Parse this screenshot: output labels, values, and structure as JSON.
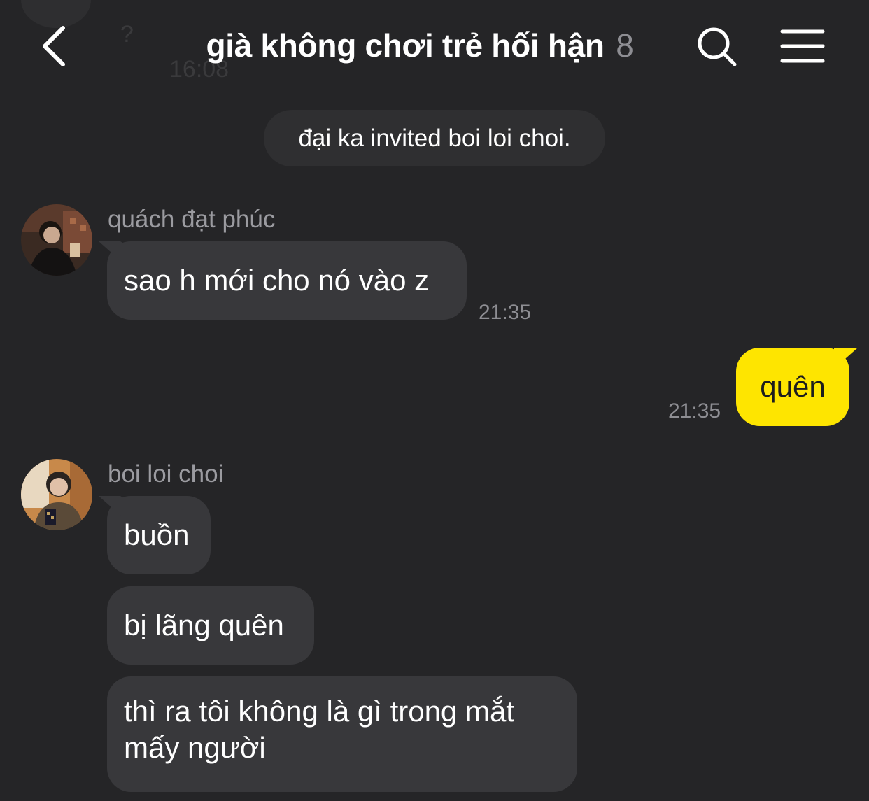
{
  "header": {
    "back_icon": "chevron-left-icon",
    "title": "già không chơi trẻ hối hận",
    "member_count": "8",
    "search_icon": "search-icon",
    "menu_icon": "hamburger-menu-icon",
    "ghost_text": {
      "question": "?",
      "time": "16:08"
    }
  },
  "system_message": "đại ka invited boi loi choi.",
  "messages": [
    {
      "sender": "quách đạt phúc",
      "text": "sao h mới cho nó vào z",
      "time": "21:35"
    },
    {
      "sender": "me",
      "text": "quên",
      "time": "21:35"
    },
    {
      "sender": "boi loi choi",
      "bubbles": [
        "buồn",
        "bị lãng quên",
        "thì ra tôi không là gì trong mắt",
        "mấy người"
      ]
    }
  ],
  "colors": {
    "background": "#252527",
    "bubble_other": "#38383b",
    "bubble_mine": "#fee500",
    "timestamp": "#8e8e93",
    "sender_name": "#9b9ba0"
  }
}
